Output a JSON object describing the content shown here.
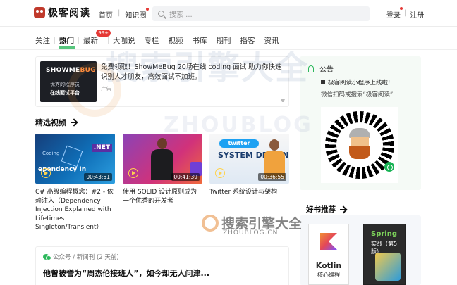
{
  "header": {
    "logo_text": "极客阅读",
    "nav": [
      "首页",
      "知识圈"
    ],
    "search_placeholder": "搜索 ...",
    "login": "登录",
    "register": "注册"
  },
  "tabs": {
    "items": [
      "关注",
      "热门",
      "最新",
      "大咖说",
      "专栏",
      "视频",
      "书库",
      "期刊",
      "播客",
      "资讯"
    ],
    "active": "热门",
    "badge": "99+"
  },
  "ad": {
    "brand_a": "SHOWME",
    "brand_b": "BUG",
    "thumb_line1": "优秀的程序员",
    "thumb_line2": "在线面试平台",
    "text": "免费领取！ShowMeBug 20场在线 coding 面试 助力你快速识别人才朋友，高效面试不加班。",
    "tag": "广告"
  },
  "videos_section": {
    "title": "精选视频",
    "items": [
      {
        "title": "C# 高级编程概念：#2 - 依赖注入（Dependency Injection Explained with Lifetimes Singleton/Transient）",
        "duration": "00:43:51",
        "art": {
          "a": "Coding",
          "b": "ependency In",
          "c": ".NET"
        }
      },
      {
        "title": "使用 SOLID 设计原则成为一个优秀的开发者",
        "duration": "00:41:39"
      },
      {
        "title": "Twitter 系统设计与架构",
        "duration": "00:36:55",
        "art": {
          "brand": "twitter",
          "text": "SYSTEM DESIGN"
        }
      }
    ]
  },
  "article": {
    "meta": "公众号 / 新闻刊 (2 天前)",
    "title": "他曾被誉为“周杰伦接班人”，如今却无人问津..."
  },
  "notice": {
    "title": "公告",
    "line1": "极客阅读小程序上线啦!",
    "line2": "微信扫码或搜索“极客阅读”"
  },
  "books": {
    "title": "好书推荐",
    "items": [
      {
        "name": "Kotlin",
        "sub": "核心编程"
      },
      {
        "name": "Spring",
        "sub": "实战（第5版）"
      }
    ]
  },
  "watermark": {
    "big": "搜索引擎大全",
    "big_en": "ZHOUBLOG",
    "small": "搜索引擎大全",
    "small_en": "ZHOUBLOG.CN"
  },
  "colors": {
    "accent": "#2db85c",
    "badge": "#e53935"
  }
}
